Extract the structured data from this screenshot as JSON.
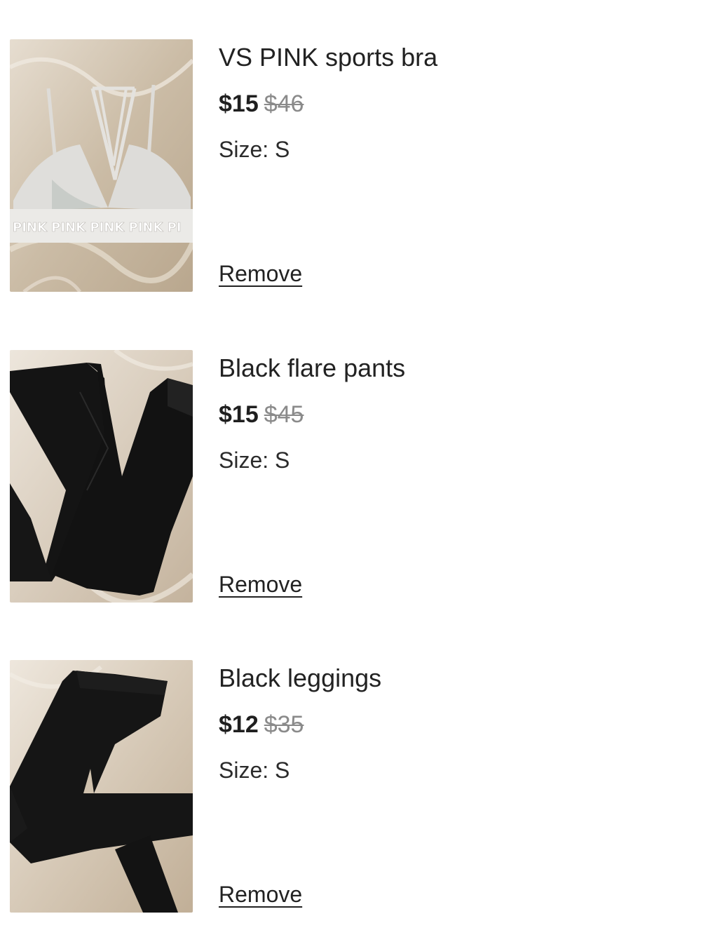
{
  "cart": {
    "items": [
      {
        "title": "VS PINK sports bra",
        "price": "$15",
        "original_price": "$46",
        "size_label": "Size: S",
        "remove_label": "Remove",
        "image_icon": "product-photo-sports-bra",
        "image_text": "PINK PINK PINK PINK PI"
      },
      {
        "title": "Black flare pants",
        "price": "$15",
        "original_price": "$45",
        "size_label": "Size: S",
        "remove_label": "Remove",
        "image_icon": "product-photo-flare-pants"
      },
      {
        "title": "Black leggings",
        "price": "$12",
        "original_price": "$35",
        "size_label": "Size: S",
        "remove_label": "Remove",
        "image_icon": "product-photo-leggings"
      }
    ]
  },
  "colors": {
    "text": "#222222",
    "price_original": "#8a8a8a",
    "background": "#ffffff",
    "photo_backdrop": "#d8cbb8",
    "garment_black": "#141414",
    "garment_white": "#e9e8e6"
  }
}
